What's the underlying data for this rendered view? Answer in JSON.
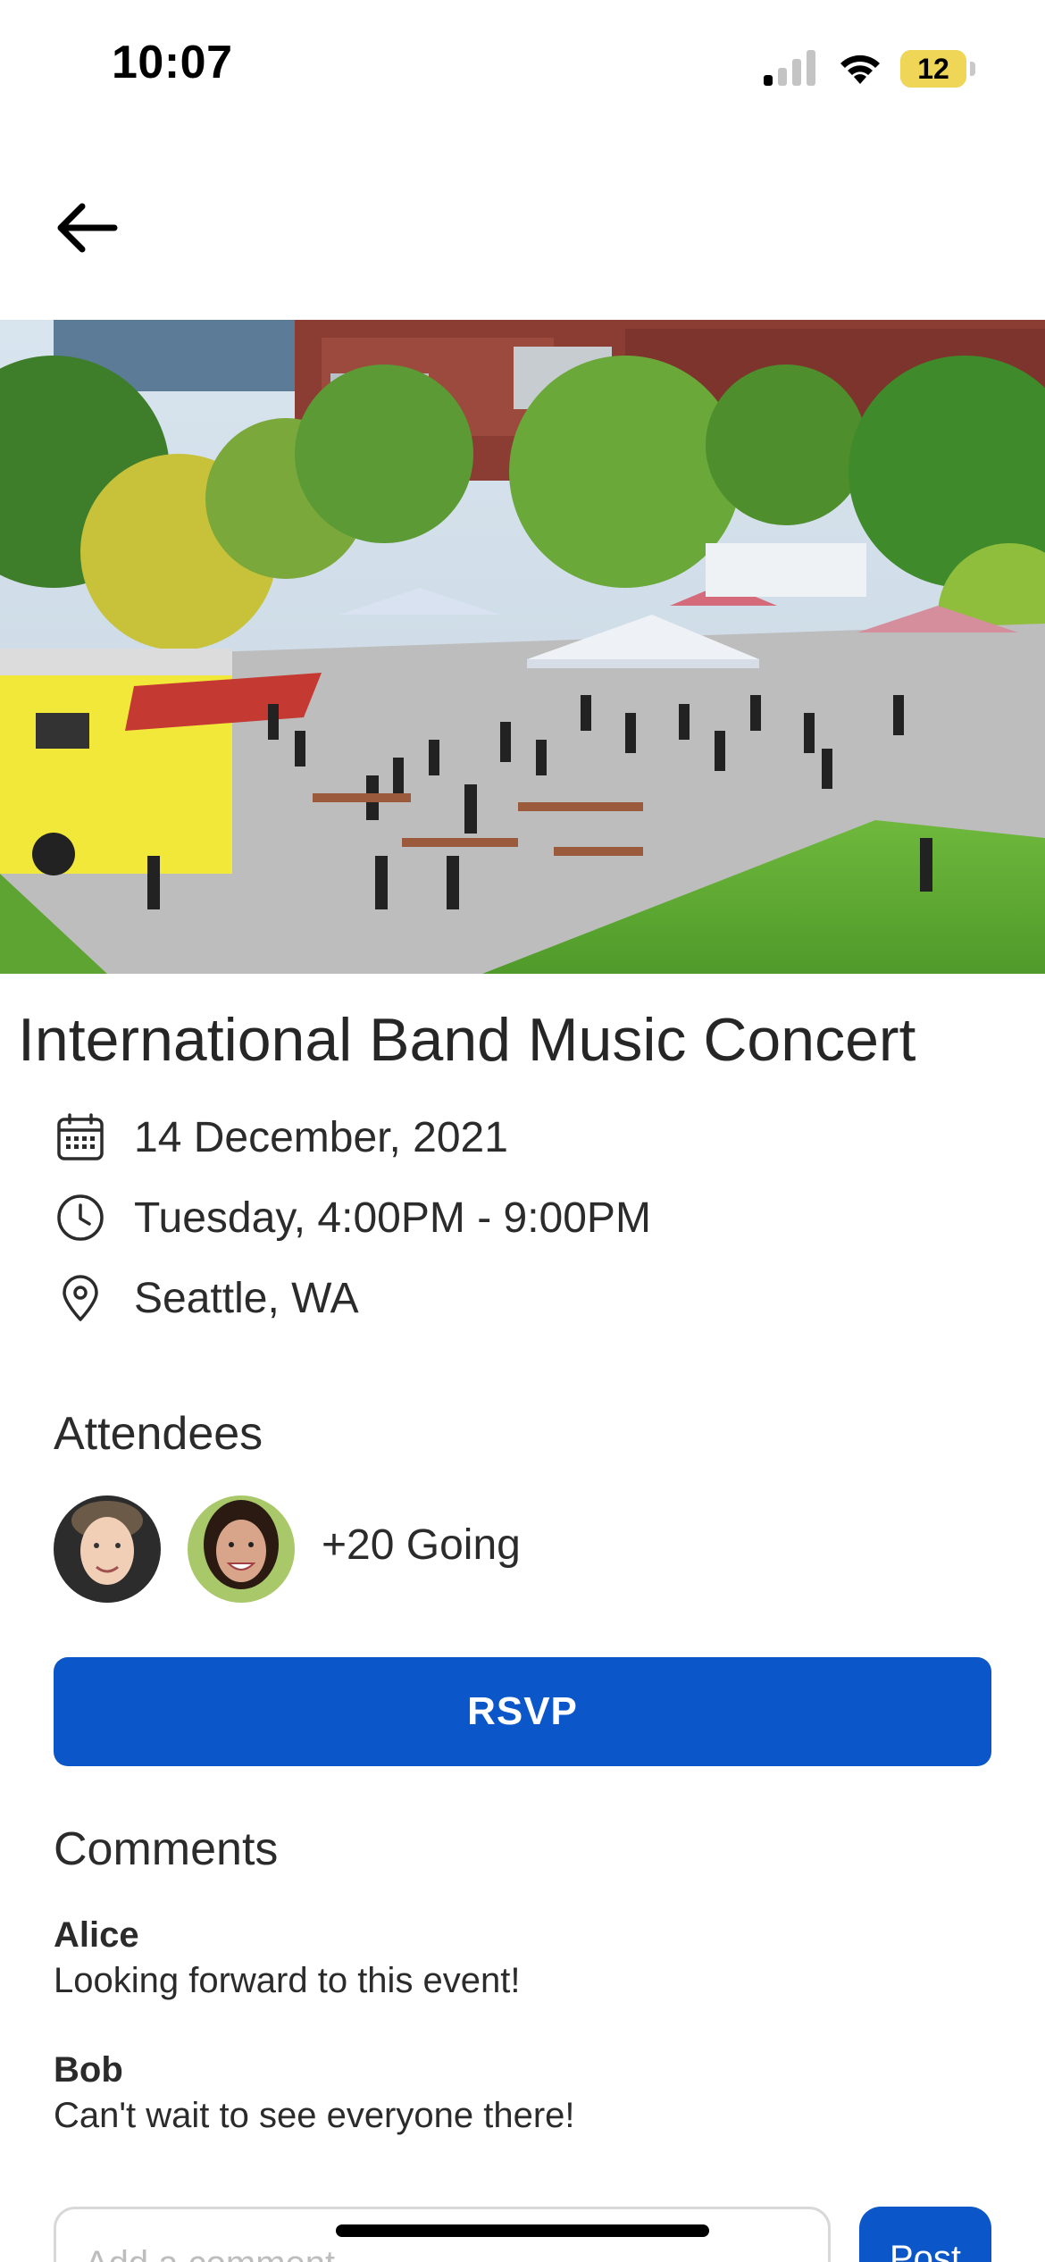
{
  "status_bar": {
    "time": "10:07",
    "battery_level": "12"
  },
  "event": {
    "title": "International Band Music Concert",
    "date": "14 December, 2021",
    "time": "Tuesday, 4:00PM - 9:00PM",
    "location": "Seattle, WA"
  },
  "attendees": {
    "heading": "Attendees",
    "going_label": "+20 Going"
  },
  "rsvp": {
    "label": "RSVP",
    "color": "#0b57c9"
  },
  "comments": {
    "heading": "Comments",
    "items": [
      {
        "author": "Alice",
        "text": "Looking forward to this event!"
      },
      {
        "author": "Bob",
        "text": "Can't wait to see everyone there!"
      }
    ],
    "input_placeholder": "Add a comment",
    "post_label": "Post"
  }
}
